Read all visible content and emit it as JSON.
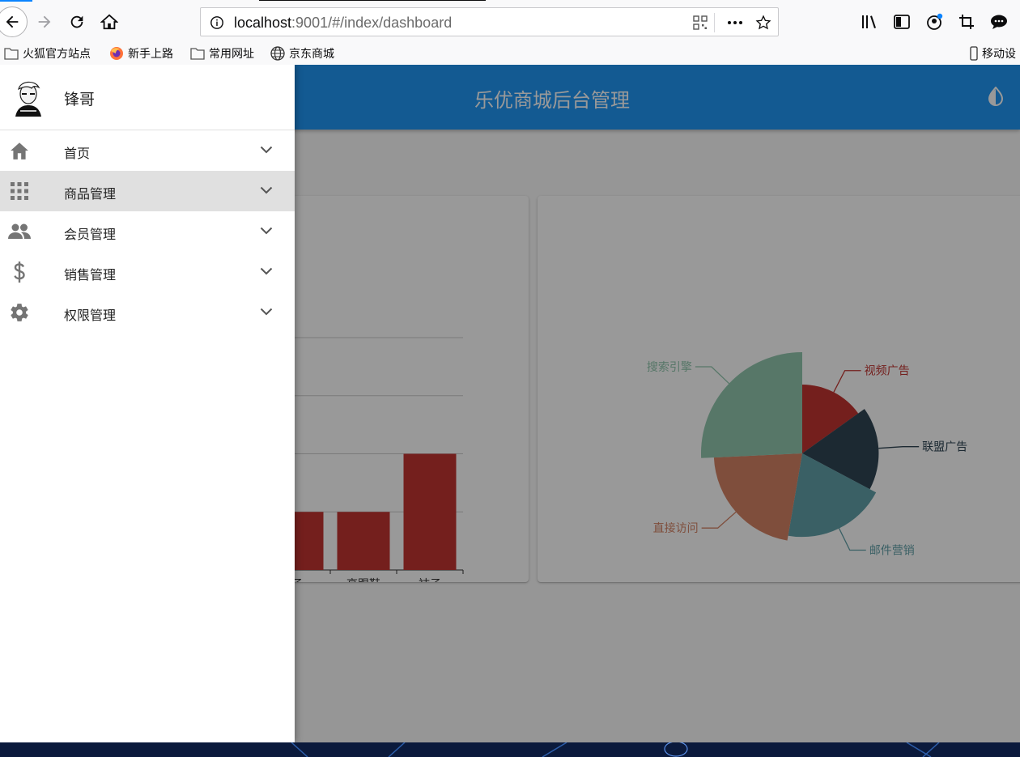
{
  "browser": {
    "url_host": "localhost",
    "url_rest": ":9001/#/index/dashboard",
    "bookmarks": [
      "火狐官方站点",
      "新手上路",
      "常用网址",
      "京东商城"
    ],
    "mobile_bookmarks": "移动设"
  },
  "app": {
    "title": "乐优商城后台管理",
    "colors": {
      "primary": "#2196f3",
      "bar": "#c23531"
    }
  },
  "drawer": {
    "username": "锋哥",
    "menu": [
      {
        "label": "首页",
        "icon": "home-icon",
        "active": false
      },
      {
        "label": "商品管理",
        "icon": "apps-grid-icon",
        "active": true
      },
      {
        "label": "会员管理",
        "icon": "people-icon",
        "active": false
      },
      {
        "label": "销售管理",
        "icon": "dollar-icon",
        "active": false
      },
      {
        "label": "权限管理",
        "icon": "gear-icon",
        "active": false
      }
    ]
  },
  "chart_data": [
    {
      "type": "bar",
      "categories": [
        "鞋子",
        "高跟鞋",
        "袜子"
      ],
      "visible_categories": [
        "子",
        "高跟鞋",
        "袜子"
      ],
      "values": [
        10,
        10,
        20
      ],
      "ylim": [
        0,
        40
      ]
    },
    {
      "type": "pie",
      "rose": true,
      "labels": [
        "视频广告",
        "联盟广告",
        "邮件营销",
        "直接访问",
        "搜索引擎"
      ],
      "values": [
        235,
        274,
        310,
        335,
        400
      ],
      "colors": [
        "#c23531",
        "#2f4554",
        "#61a0a8",
        "#d48265",
        "#91c7ae"
      ]
    }
  ]
}
